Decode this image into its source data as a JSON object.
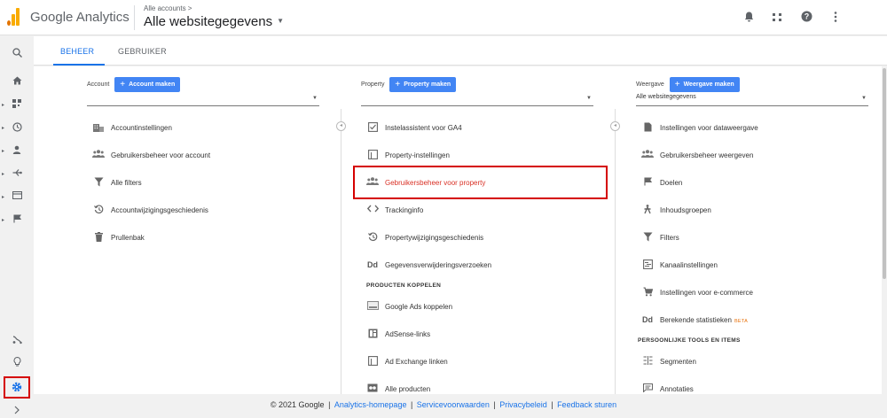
{
  "header": {
    "brand": "Google Analytics",
    "crumb": "Alle accounts >",
    "property": "Alle websitegegevens",
    "icons": [
      "bell-icon",
      "apps-icon",
      "help-icon",
      "more-icon"
    ]
  },
  "tabs": [
    {
      "label": "BEHEER",
      "active": true
    },
    {
      "label": "GEBRUIKER",
      "active": false
    }
  ],
  "account": {
    "label": "Account",
    "button": "Account maken",
    "select_value": "",
    "items": [
      {
        "label": "Accountinstellingen",
        "icon": "building-icon"
      },
      {
        "label": "Gebruikersbeheer voor account",
        "icon": "users-icon"
      },
      {
        "label": "Alle filters",
        "icon": "filter-icon"
      },
      {
        "label": "Accountwijzigingsgeschiedenis",
        "icon": "history-icon"
      },
      {
        "label": "Prullenbak",
        "icon": "trash-icon"
      }
    ]
  },
  "property_col": {
    "label": "Property",
    "button": "Property maken",
    "select_value": "",
    "items": [
      {
        "label": "Instelassistent voor GA4",
        "icon": "checkbox-icon"
      },
      {
        "label": "Property-instellingen",
        "icon": "settings-box-icon"
      },
      {
        "label": "Gebruikersbeheer voor property",
        "icon": "users-icon"
      },
      {
        "label": "Trackinginfo",
        "icon": "code-icon"
      },
      {
        "label": "Propertywijzigingsgeschiedenis",
        "icon": "history-icon"
      },
      {
        "label": "Gegevensverwijderingsverzoeken",
        "icon": "dd-icon"
      }
    ],
    "section": "PRODUCTEN KOPPELEN",
    "link_items": [
      {
        "label": "Google Ads koppelen",
        "icon": "ads-icon"
      },
      {
        "label": "AdSense-links",
        "icon": "adsense-icon"
      },
      {
        "label": "Ad Exchange linken",
        "icon": "adexchange-icon"
      },
      {
        "label": "Alle producten",
        "icon": "link-icon"
      }
    ]
  },
  "view": {
    "label": "Weergave",
    "button": "Weergave maken",
    "select_value": "Alle websitegegevens",
    "items": [
      {
        "label": "Instellingen voor dataweergave",
        "icon": "file-icon"
      },
      {
        "label": "Gebruikersbeheer weergeven",
        "icon": "users-icon"
      },
      {
        "label": "Doelen",
        "icon": "flag-icon"
      },
      {
        "label": "Inhoudsgroepen",
        "icon": "person-walk-icon"
      },
      {
        "label": "Filters",
        "icon": "filter-icon"
      },
      {
        "label": "Kanaalinstellingen",
        "icon": "channel-icon"
      },
      {
        "label": "Instellingen voor e-commerce",
        "icon": "cart-icon"
      },
      {
        "label": "Berekende statistieken",
        "icon": "dd-icon",
        "badge": "BETA"
      }
    ],
    "section": "PERSOONLIJKE TOOLS EN ITEMS",
    "tool_items": [
      {
        "label": "Segmenten",
        "icon": "segments-icon"
      },
      {
        "label": "Annotaties",
        "icon": "annotation-icon"
      }
    ]
  },
  "footer": {
    "copyright": "© 2021 Google",
    "links": [
      "Analytics-homepage",
      "Servicevoorwaarden",
      "Privacybeleid",
      "Feedback sturen"
    ]
  },
  "colors": {
    "accent": "#1a73e8",
    "button": "#4285f4",
    "highlight_border": "#d50000",
    "selected_text": "#d93025"
  }
}
